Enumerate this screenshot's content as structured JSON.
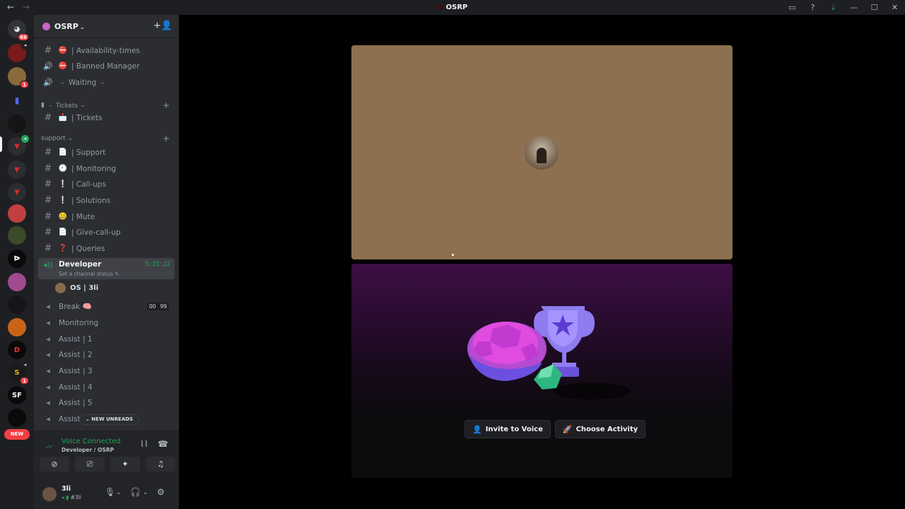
{
  "window": {
    "title": "OSRP",
    "nav_back": "←",
    "nav_forward": "→",
    "tools": [
      "▭",
      "?",
      "⤓",
      "—",
      "☐",
      "✕"
    ]
  },
  "rail": {
    "home_badge": "66",
    "badges": {
      "s2": "1",
      "s13": "1"
    },
    "new_label": "NEW"
  },
  "server": {
    "name": "OSRP",
    "chevron": "⌄",
    "invite_icon": "+👤"
  },
  "channels": {
    "top": [
      {
        "icon": "#",
        "emoji": "⛔",
        "name": "| Availability-times",
        "type": "text"
      },
      {
        "icon": "🔊",
        "emoji": "⛔",
        "name": "| Banned Manager",
        "type": "voice"
      },
      {
        "icon": "🔊",
        "emoji": "",
        "name": "﹣ Waiting ﹣",
        "type": "voice"
      }
    ],
    "tickets_category": "﹣ Tickets",
    "tickets": [
      {
        "icon": "#",
        "emoji": "📩",
        "name": "| Tickets"
      }
    ],
    "support_category": "support",
    "support": [
      {
        "icon": "#",
        "emoji": "📄",
        "name": "| Support"
      },
      {
        "icon": "#",
        "emoji": "🕘",
        "name": "| Monitoring"
      },
      {
        "icon": "#",
        "emoji": "❕",
        "name": "| Call-ups"
      },
      {
        "icon": "#",
        "emoji": "❕",
        "name": "| Solutions"
      },
      {
        "icon": "#",
        "emoji": "🤐",
        "name": "| Mute"
      },
      {
        "icon": "#",
        "emoji": "📄",
        "name": "| Give-call-up"
      },
      {
        "icon": "#",
        "emoji": "❓",
        "name": "| Queries"
      }
    ],
    "active": {
      "name": "Developer",
      "status": "Set a channel status ✎",
      "timer": "5:25:22",
      "member": "OS | 3li"
    },
    "break": {
      "name": "Break 🧠",
      "counter_a": "00",
      "counter_b": "99"
    },
    "voice_list": [
      "Monitoring",
      "Assist | 1",
      "Assist | 2",
      "Assist | 3",
      "Assist | 4",
      "Assist | 5",
      "Assist |"
    ],
    "new_unreads": "⌄ NEW UNREADS"
  },
  "voice_panel": {
    "status": "Voice Connected",
    "location": "Developer / OSRP"
  },
  "user": {
    "name": "3li",
    "tag": "#3li"
  },
  "activity": {
    "invite_label": "Invite to Voice",
    "choose_label": "Choose Activity"
  },
  "colors": {
    "green": "#23a55a",
    "red": "#f23f43",
    "tile_bg": "#8c704f",
    "sidebar": "#2b2d31",
    "rail": "#1e1f22"
  }
}
